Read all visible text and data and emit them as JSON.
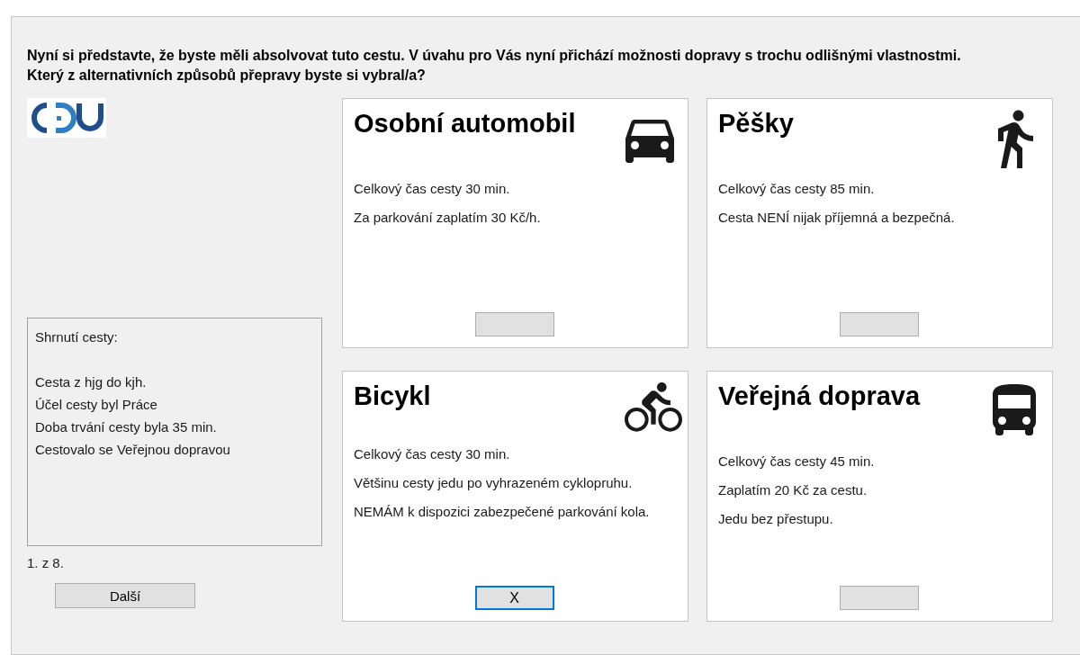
{
  "question": "Nyní si představte, že byste měli absolvovat tuto cestu. V úvahu pro Vás nyní přichází možnosti dopravy s trochu odlišnými vlastnostmi. Který z alternativních způsobů přepravy byste si vybral/a?",
  "summary": {
    "title": "Shrnutí cesty:",
    "lines": [
      "Cesta z hjg do kjh.",
      "Účel cesty byl Práce",
      "Doba trvání cesty byla 35 min.",
      "Cestovalo se Veřejnou dopravou"
    ]
  },
  "progress": "1. z 8.",
  "next_button": "Další",
  "choice_mark": "X",
  "options": [
    {
      "title": "Osobní automobil",
      "kind": "car",
      "lines": [
        "Celkový čas cesty 30 min.",
        "Za parkování zaplatím 30 Kč/h."
      ],
      "selected": false
    },
    {
      "title": "Pěšky",
      "kind": "walk",
      "lines": [
        "Celkový čas cesty 85 min.",
        "Cesta NENÍ nijak příjemná a bezpečná."
      ],
      "selected": false
    },
    {
      "title": "Bicykl",
      "kind": "bike",
      "lines": [
        "Celkový čas cesty 30 min.",
        "Většinu cesty jedu po vyhrazeném cyklopruhu.",
        "NEMÁM k dispozici zabezpečené parkování kola."
      ],
      "selected": true
    },
    {
      "title": "Veřejná doprava",
      "kind": "bus",
      "lines": [
        "Celkový čas cesty 45 min.",
        "Zaplatím 20 Kč za cestu.",
        "Jedu bez přestupu."
      ],
      "selected": false
    }
  ]
}
